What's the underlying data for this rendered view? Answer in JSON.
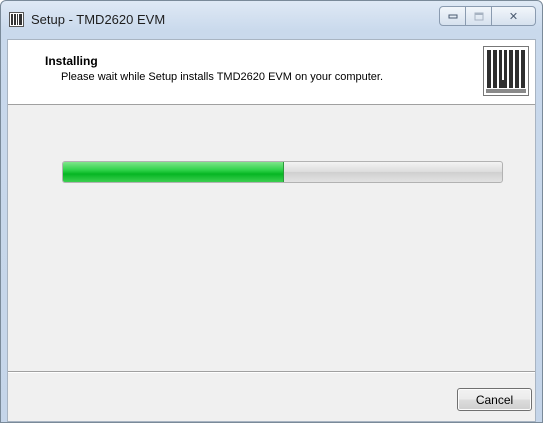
{
  "window": {
    "title": "Setup - TMD2620 EVM"
  },
  "caption_buttons": {
    "minimize_icon": "minimize-icon",
    "maximize_icon": "maximize-icon",
    "close_icon": "close-icon",
    "close_glyph": "✕"
  },
  "header": {
    "title": "Installing",
    "subtitle": "Please wait while Setup installs TMD2620 EVM on your computer."
  },
  "progress": {
    "fraction": 0.5,
    "fill_color": "#06b623"
  },
  "footer": {
    "cancel_label": "Cancel"
  },
  "colors": {
    "accent_green": "#06b623",
    "client_bg": "#f0f0f0"
  }
}
